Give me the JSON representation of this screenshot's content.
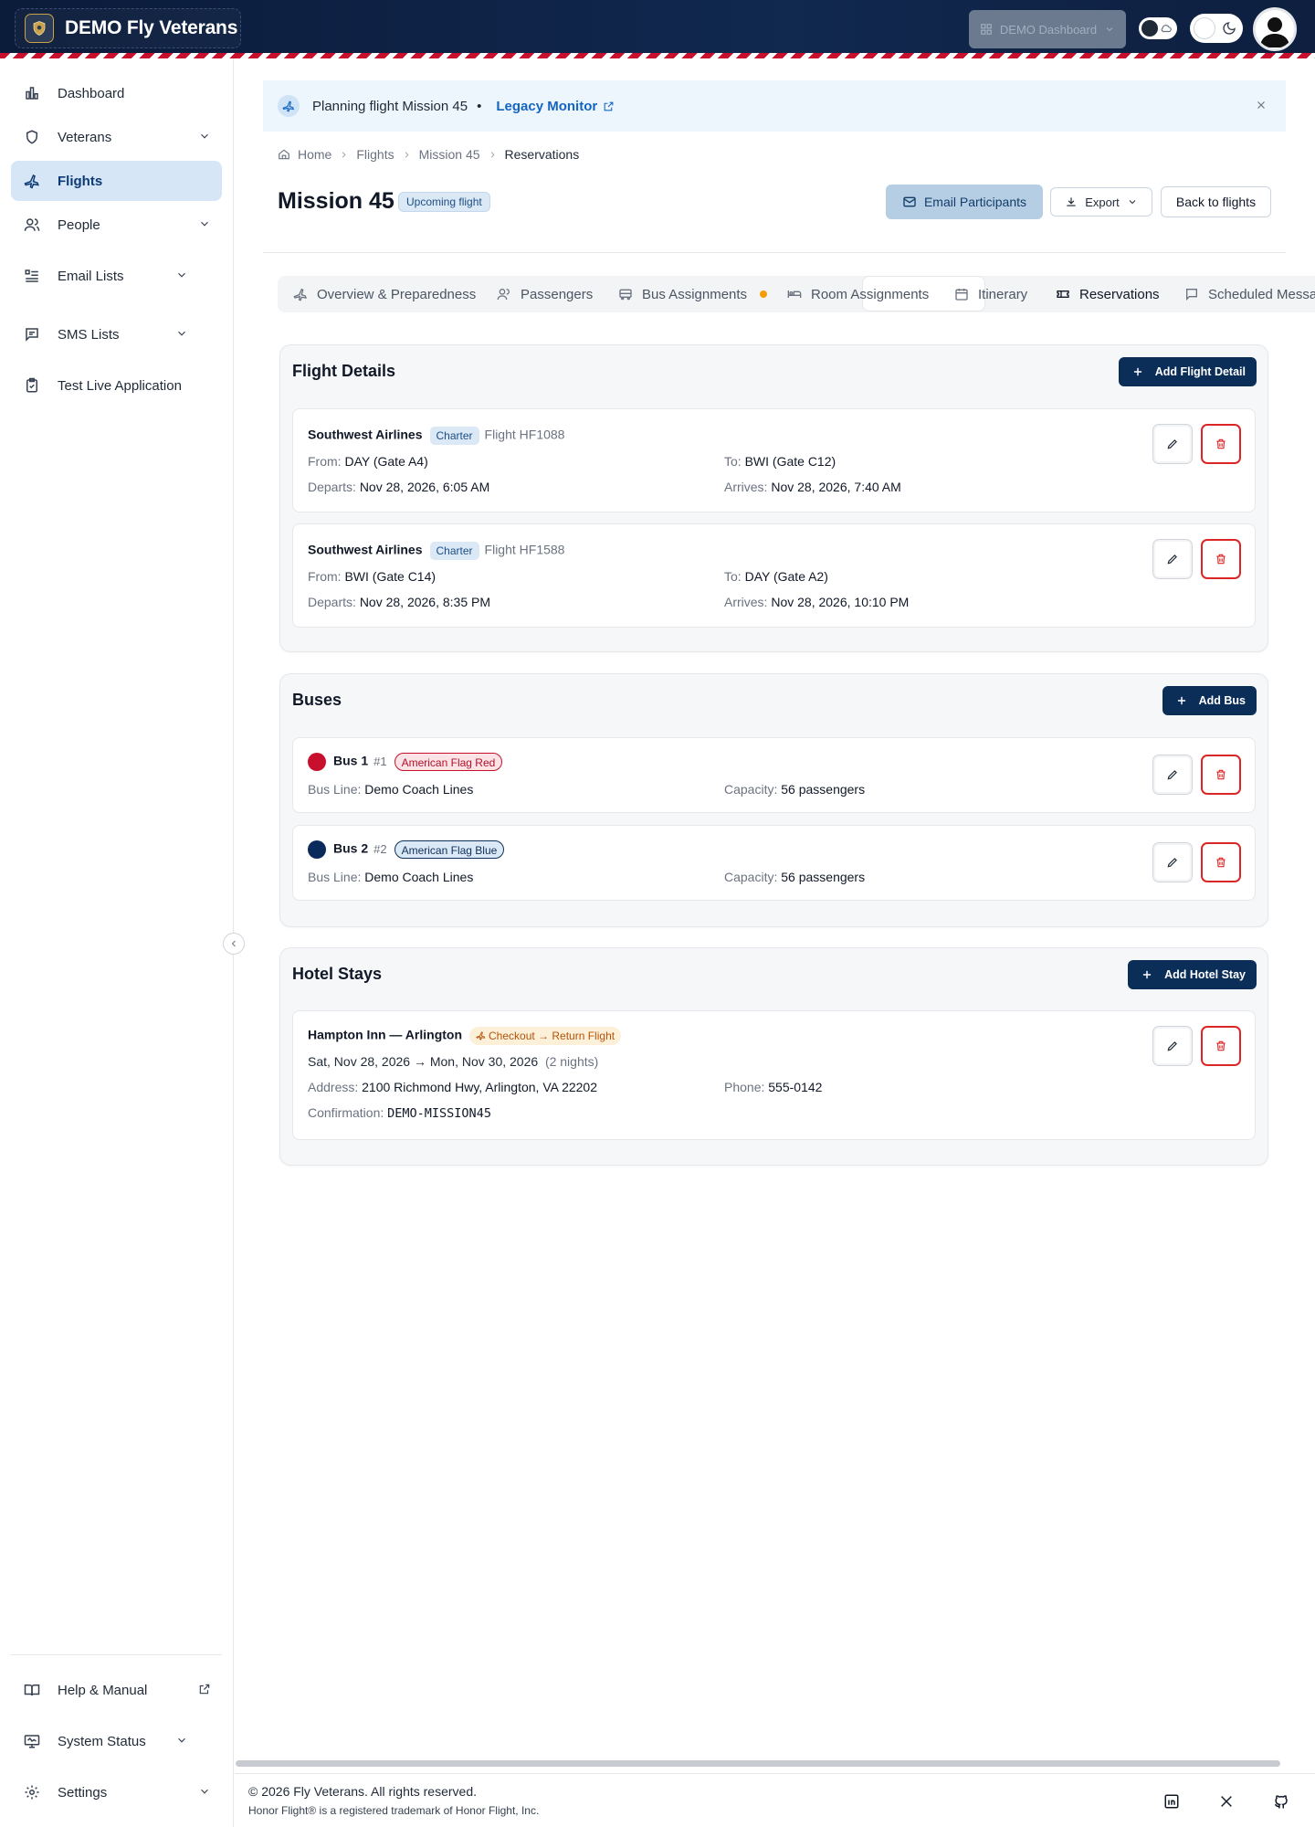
{
  "brand": {
    "name": "DEMO Fly Veterans",
    "logo_icon": "shield-logo-icon"
  },
  "header": {
    "demo_dashboard_label": "DEMO Dashboard"
  },
  "sidebar": {
    "items": [
      {
        "label": "Dashboard",
        "icon": "bar-chart-icon"
      },
      {
        "label": "Veterans",
        "icon": "shield-icon"
      },
      {
        "label": "Flights",
        "icon": "plane-icon",
        "active": true
      },
      {
        "label": "People",
        "icon": "users-icon"
      },
      {
        "label": "Email Lists",
        "icon": "list-icon"
      },
      {
        "label": "SMS Lists",
        "icon": "message-icon"
      },
      {
        "label": "Test Live Application",
        "icon": "clipboard-icon"
      }
    ],
    "bottom": [
      {
        "label": "Help & Manual",
        "icon": "book-icon"
      },
      {
        "label": "System Status",
        "icon": "monitor-icon"
      },
      {
        "label": "Settings",
        "icon": "gear-icon"
      }
    ]
  },
  "banner": {
    "text": "Planning flight Mission 45",
    "separator": "•",
    "link": "Legacy Monitor"
  },
  "breadcrumb": [
    "Home",
    "Flights",
    "Mission 45",
    "Reservations"
  ],
  "page": {
    "title": "Mission 45",
    "status_badge": "Upcoming flight",
    "email_button": "Email Participants",
    "export_button": "Export",
    "back_button": "Back to flights"
  },
  "tabs": [
    "Overview & Preparedness",
    "Passengers",
    "Bus Assignments",
    "Room Assignments",
    "Itinerary",
    "Reservations",
    "Scheduled Messag"
  ],
  "flight_details": {
    "title": "Flight Details",
    "add_label": "Add Flight Detail",
    "items": [
      {
        "airline": "Southwest Airlines",
        "type": "Charter",
        "flight": "Flight HF1088",
        "from_label": "From:",
        "from": "DAY (Gate A4)",
        "to_label": "To:",
        "to": "BWI (Gate C12)",
        "departs_label": "Departs:",
        "departs": "Nov 28, 2026, 6:05 AM",
        "arrives_label": "Arrives:",
        "arrives": "Nov 28, 2026, 7:40 AM"
      },
      {
        "airline": "Southwest Airlines",
        "type": "Charter",
        "flight": "Flight HF1588",
        "from_label": "From:",
        "from": "BWI (Gate C14)",
        "to_label": "To:",
        "to": "DAY (Gate A2)",
        "departs_label": "Departs:",
        "departs": "Nov 28, 2026, 8:35 PM",
        "arrives_label": "Arrives:",
        "arrives": "Nov 28, 2026, 10:10 PM"
      }
    ]
  },
  "buses": {
    "title": "Buses",
    "add_label": "Add Bus",
    "items": [
      {
        "name": "Bus 1",
        "number": "#1",
        "color_name": "American Flag Red",
        "color": "#c8102e",
        "line_label": "Bus Line:",
        "line": "Demo Coach Lines",
        "capacity_label": "Capacity:",
        "capacity": "56 passengers"
      },
      {
        "name": "Bus 2",
        "number": "#2",
        "color_name": "American Flag Blue",
        "color": "#0a2a5c",
        "line_label": "Bus Line:",
        "line": "Demo Coach Lines",
        "capacity_label": "Capacity:",
        "capacity": "56 passengers"
      }
    ]
  },
  "hotel": {
    "title": "Hotel Stays",
    "add_label": "Add Hotel Stay",
    "items": [
      {
        "name": "Hampton Inn — Arlington",
        "badge": "Checkout → Return Flight",
        "dates": "Sat, Nov 28, 2026 → Mon, Nov 30, 2026",
        "nights": "(2 nights)",
        "address_label": "Address:",
        "address": "2100 Richmond Hwy, Arlington, VA 22202",
        "phone_label": "Phone:",
        "phone": "555-0142",
        "confirmation_label": "Confirmation:",
        "confirmation": "DEMO-MISSION45"
      }
    ]
  },
  "footer": {
    "copyright": "© 2026 Fly Veterans. All rights reserved.",
    "trademark": "Honor Flight® is a registered trademark of Honor Flight, Inc.",
    "social_icons": [
      "linkedin-icon",
      "x-icon",
      "github-icon"
    ]
  },
  "colors": {
    "navy": "#0b2e59",
    "flag_red": "#c8102e",
    "active_nav": "#d6e6f7",
    "danger": "#dc2626"
  }
}
